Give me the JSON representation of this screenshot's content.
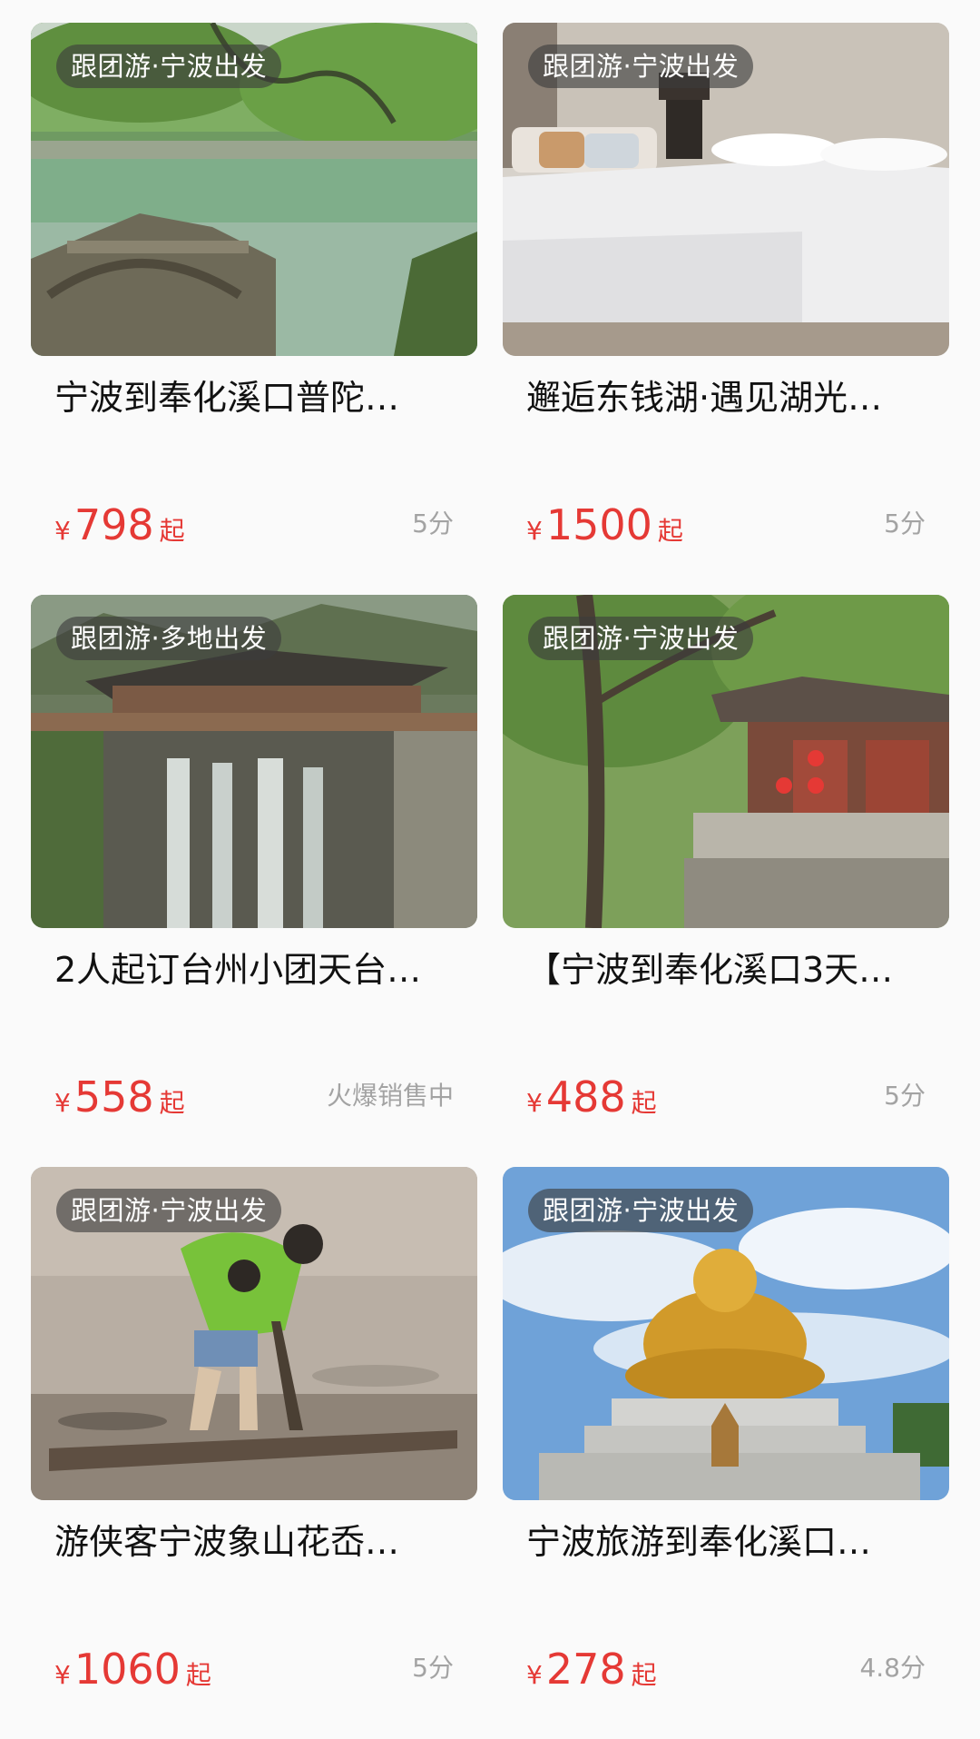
{
  "colors": {
    "price_red": "#e53935",
    "score_gray": "#a3a3a3",
    "tag_bg": "rgba(60,60,60,0.62)",
    "background": "#fafafa"
  },
  "cards": [
    {
      "tag": "跟团游·宁波出发",
      "title": "宁波到奉化溪口普陀…",
      "currency": "¥",
      "price": "798",
      "price_suffix": "起",
      "score": "5分",
      "image": "lake-stone-bridge-photo"
    },
    {
      "tag": "跟团游·宁波出发",
      "title": "邂逅东钱湖·遇见湖光…",
      "currency": "¥",
      "price": "1500",
      "price_suffix": "起",
      "score": "5分",
      "image": "hotel-bedroom-photo"
    },
    {
      "tag": "跟团游·多地出发",
      "title": "2人起订台州小团天台…",
      "currency": "¥",
      "price": "558",
      "price_suffix": "起",
      "score": "火爆销售中",
      "image": "covered-bridge-waterfall-photo"
    },
    {
      "tag": "跟团游·宁波出发",
      "title": "【宁波到奉化溪口3天…",
      "currency": "¥",
      "price": "488",
      "price_suffix": "起",
      "score": "5分",
      "image": "pavilion-red-lanterns-photo"
    },
    {
      "tag": "跟团游·宁波出发",
      "title": "游侠客宁波象山花岙…",
      "currency": "¥",
      "price": "1060",
      "price_suffix": "起",
      "score": "5分",
      "image": "mudflat-digging-photo"
    },
    {
      "tag": "跟团游·宁波出发",
      "title": "宁波旅游到奉化溪口…",
      "currency": "¥",
      "price": "278",
      "price_suffix": "起",
      "score": "4.8分",
      "image": "golden-buddha-statue-photo"
    }
  ]
}
